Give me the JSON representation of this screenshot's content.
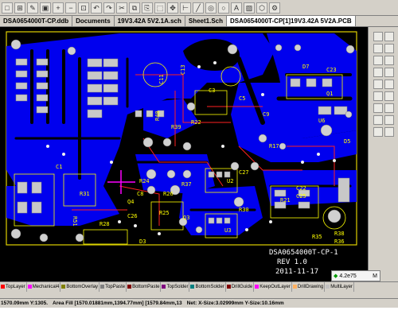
{
  "toolbar": {
    "buttons": [
      "new-icon",
      "open-icon",
      "save-icon",
      "print-icon",
      "zoom-in-icon",
      "zoom-out-icon",
      "zoom-fit-icon",
      "undo-icon",
      "redo-icon",
      "cut-icon",
      "copy-icon",
      "paste-icon",
      "select-icon",
      "move-icon",
      "measure-icon",
      "route-icon",
      "via-icon",
      "pad-icon",
      "text-icon",
      "fill-icon",
      "polygon-icon",
      "settings-icon"
    ],
    "glyphs": [
      "□",
      "⊞",
      "✎",
      "▣",
      "+",
      "−",
      "⊡",
      "↶",
      "↷",
      "✂",
      "⧉",
      "⎘",
      "⬚",
      "✥",
      "⊢",
      "╱",
      "◎",
      "○",
      "A",
      "▨",
      "⬡",
      "⚙"
    ]
  },
  "tabs": [
    {
      "label": "DSA0654000T-CP.ddb",
      "active": false
    },
    {
      "label": "Documents",
      "active": false
    },
    {
      "label": "19V3.42A 5V2.1A.sch",
      "active": false
    },
    {
      "label": "Sheet1.Sch",
      "active": false
    },
    {
      "label": "DSA0654000T-CP[1]19V3.42A 5V2A.PCB",
      "active": true
    }
  ],
  "board": {
    "part_number": "DSA0654000T-CP-1",
    "revision": "REV 1.0",
    "date": "2011-11-17",
    "designators": [
      "C11",
      "C13",
      "R40",
      "R22",
      "R39",
      "C3",
      "C5",
      "D7",
      "C23",
      "Q1",
      "C9",
      "R37",
      "C22",
      "C25",
      "R38",
      "R36",
      "R35",
      "U2",
      "U3",
      "R24",
      "R25",
      "R26",
      "R30",
      "R31",
      "R28",
      "C26",
      "D5",
      "U6",
      "R17",
      "R21",
      "C27",
      "C1",
      "R51",
      "C8",
      "Q4",
      "Q3",
      "D3"
    ],
    "colors": {
      "board": "#000000",
      "copper_bottom": "#0000ff",
      "copper_top": "#ff0000",
      "silkscreen": "#ffff00",
      "pad": "#c0c0c0",
      "outline": "#e0d000"
    }
  },
  "right_toolbar": {
    "buttons": [
      "layer-top-icon",
      "layer-bottom-icon",
      "grid-icon",
      "snap-icon",
      "place-icon",
      "wire-icon",
      "via-icon",
      "arc-icon",
      "fill-icon",
      "dimension-icon",
      "origin-icon",
      "jump-icon",
      "highlight-icon",
      "inspect-icon",
      "drc-icon",
      "net-icon",
      "component-icon",
      "board-icon"
    ]
  },
  "zoom": {
    "value": "4.2e75",
    "secondary": "M"
  },
  "layers": [
    {
      "label": "TopLayer",
      "color": "#ff0000"
    },
    {
      "label": "Mechanical4",
      "color": "#ff00ff"
    },
    {
      "label": "BottomOverlay",
      "color": "#808000"
    },
    {
      "label": "TopPaste",
      "color": "#808080"
    },
    {
      "label": "BottomPaste",
      "color": "#800000"
    },
    {
      "label": "TopSolder",
      "color": "#800080"
    },
    {
      "label": "BottomSolder",
      "color": "#008080"
    },
    {
      "label": "DrillGuide",
      "color": "#800000"
    },
    {
      "label": "KeepOutLayer",
      "color": "#ff00ff"
    },
    {
      "label": "DrillDrawing",
      "color": "#ffb060"
    },
    {
      "label": "MultiLayer",
      "color": "#c0c0c0"
    }
  ],
  "status": {
    "coords": "1570.09mm Y:1305.",
    "area_fill": "Area Fill [1570.01881mm,1394.77mm] [1579.84mm,13",
    "net": "Net: X-Size:3.02999mm Y-Size:10.16mm"
  }
}
